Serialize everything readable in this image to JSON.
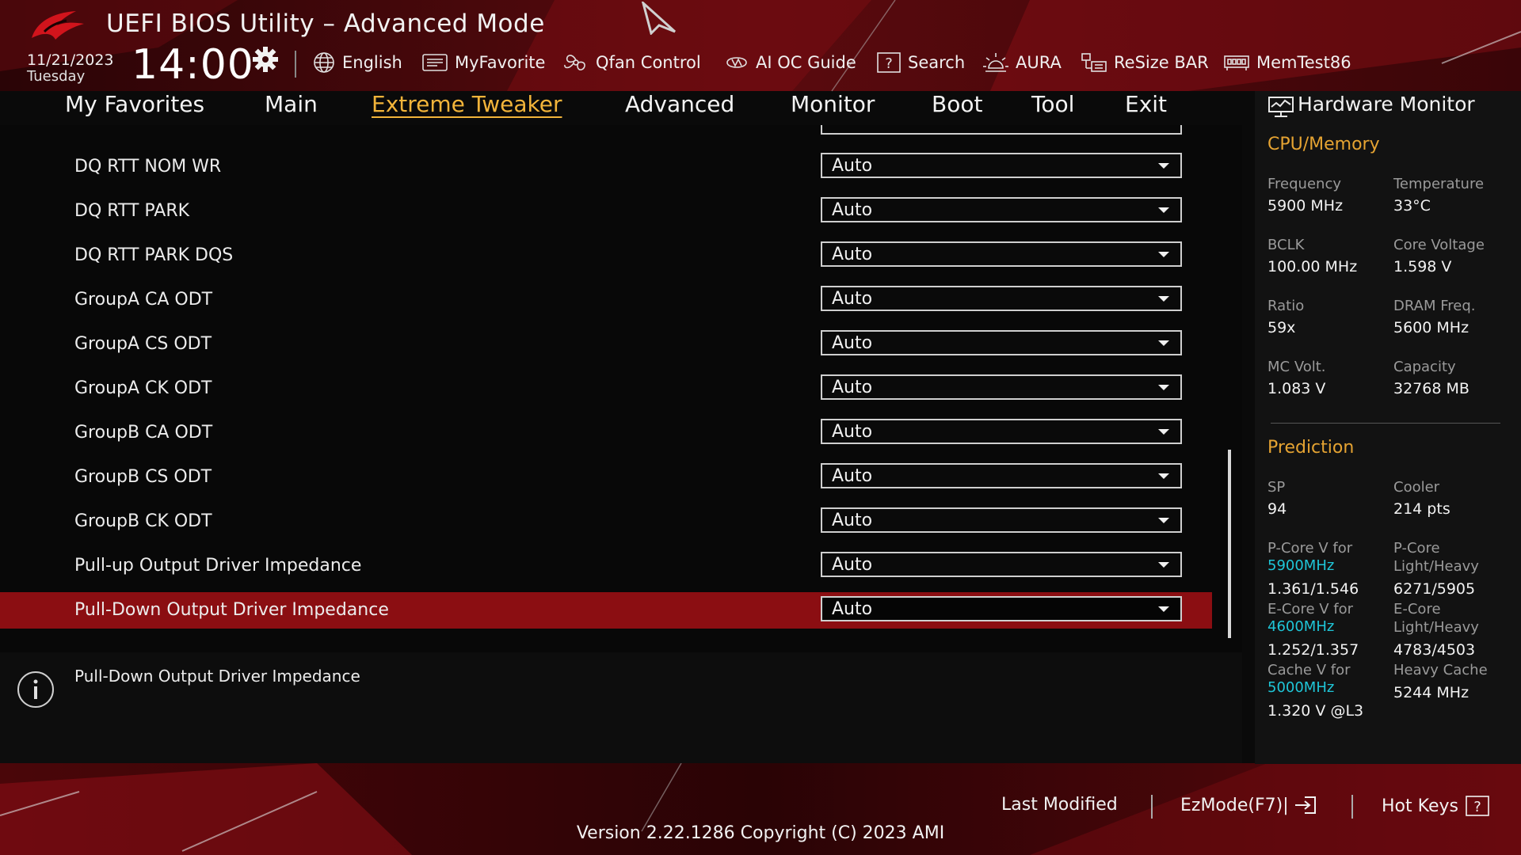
{
  "colors": {
    "accent": "#f2b43a",
    "section": "#e5a332",
    "cyan": "#1fc6d8",
    "selected_row": "#8b0e12",
    "brand_red": "#c4111a"
  },
  "header": {
    "title": "UEFI BIOS Utility – Advanced Mode",
    "date": "11/21/2023",
    "day": "Tuesday",
    "time": "14:00"
  },
  "toolbar": [
    {
      "label": "English",
      "icon": "globe-icon"
    },
    {
      "label": "MyFavorite",
      "icon": "favorite-icon"
    },
    {
      "label": "Qfan Control",
      "icon": "fan-icon"
    },
    {
      "label": "AI OC Guide",
      "icon": "ai-chip-icon"
    },
    {
      "label": "Search",
      "icon": "search-icon"
    },
    {
      "label": "AURA",
      "icon": "aura-icon"
    },
    {
      "label": "ReSize BAR",
      "icon": "resize-bar-icon"
    },
    {
      "label": "MemTest86",
      "icon": "memtest-icon"
    }
  ],
  "nav": {
    "tabs": [
      "My Favorites",
      "Main",
      "Extreme Tweaker",
      "Advanced",
      "Monitor",
      "Boot",
      "Tool",
      "Exit"
    ],
    "active": "Extreme Tweaker"
  },
  "settings": [
    {
      "label": "DQ RTT NOM WR",
      "value": "Auto"
    },
    {
      "label": "DQ RTT PARK",
      "value": "Auto"
    },
    {
      "label": "DQ RTT PARK DQS",
      "value": "Auto"
    },
    {
      "label": "GroupA CA ODT",
      "value": "Auto"
    },
    {
      "label": "GroupA CS ODT",
      "value": "Auto"
    },
    {
      "label": "GroupA CK ODT",
      "value": "Auto"
    },
    {
      "label": "GroupB CA ODT",
      "value": "Auto"
    },
    {
      "label": "GroupB CS ODT",
      "value": "Auto"
    },
    {
      "label": "GroupB CK ODT",
      "value": "Auto"
    },
    {
      "label": "Pull-up Output Driver Impedance",
      "value": "Auto"
    },
    {
      "label": "Pull-Down Output Driver Impedance",
      "value": "Auto",
      "selected": true
    }
  ],
  "help": {
    "text": "Pull-Down Output Driver Impedance"
  },
  "hardware_monitor": {
    "title": "Hardware Monitor",
    "cpu_memory": {
      "heading": "CPU/Memory",
      "frequency_label": "Frequency",
      "frequency": "5900 MHz",
      "temperature_label": "Temperature",
      "temperature": "33°C",
      "bclk_label": "BCLK",
      "bclk": "100.00 MHz",
      "core_voltage_label": "Core Voltage",
      "core_voltage": "1.598 V",
      "ratio_label": "Ratio",
      "ratio": "59x",
      "dram_freq_label": "DRAM Freq.",
      "dram_freq": "5600 MHz",
      "mc_volt_label": "MC Volt.",
      "mc_volt": "1.083 V",
      "capacity_label": "Capacity",
      "capacity": "32768 MB"
    },
    "prediction": {
      "heading": "Prediction",
      "sp_label": "SP",
      "sp": "94",
      "cooler_label": "Cooler",
      "cooler": "214 pts",
      "pcore_v_label": "P-Core V for",
      "pcore_v_freq": "5900MHz",
      "pcore_v": "1.361/1.546",
      "pcore_lh_label1": "P-Core",
      "pcore_lh_label2": "Light/Heavy",
      "pcore_lh": "6271/5905",
      "ecore_v_label": "E-Core V for",
      "ecore_v_freq": "4600MHz",
      "ecore_v": "1.252/1.357",
      "ecore_lh_label1": "E-Core",
      "ecore_lh_label2": "Light/Heavy",
      "ecore_lh": "4783/4503",
      "cache_v_label": "Cache V for",
      "cache_v_freq": "5000MHz",
      "cache_v": "1.320 V @L3",
      "heavy_cache_label": "Heavy Cache",
      "heavy_cache": "5244 MHz"
    }
  },
  "footer": {
    "last_modified": "Last Modified",
    "ezmode": "EzMode(F7)|",
    "hot_keys": "Hot Keys",
    "version": "Version 2.22.1286 Copyright (C) 2023 AMI"
  }
}
